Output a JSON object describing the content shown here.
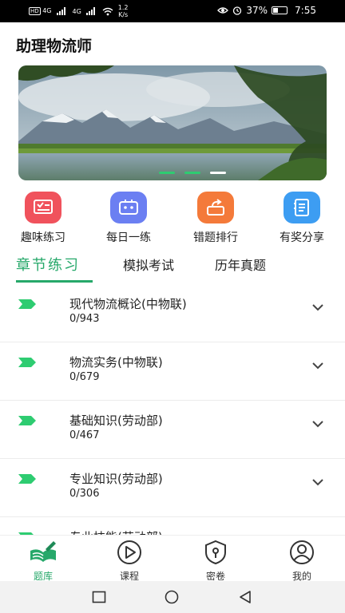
{
  "status_bar": {
    "network_left": "4G",
    "network_left2": "4G",
    "speed_value": "1.2",
    "speed_unit": "K/s",
    "battery": "37%",
    "time": "7:55"
  },
  "header": {
    "title": "助理物流师"
  },
  "banner": {
    "active_dot_index": 2,
    "dot_count": 3
  },
  "quick_menu": [
    {
      "label": "趣味练习",
      "icon": "quiz-icon",
      "color": "#f0525c"
    },
    {
      "label": "每日一练",
      "icon": "daily-icon",
      "color": "#6b7ff2"
    },
    {
      "label": "错题排行",
      "icon": "ranking-icon",
      "color": "#f47a3a"
    },
    {
      "label": "有奖分享",
      "icon": "share-icon",
      "color": "#3d9df2"
    }
  ],
  "tabs": [
    {
      "label": "章节练习",
      "active": true
    },
    {
      "label": "模拟考试",
      "active": false
    },
    {
      "label": "历年真题",
      "active": false
    }
  ],
  "chapters": [
    {
      "name": "现代物流概论(中物联)",
      "progress": "0/943"
    },
    {
      "name": "物流实务(中物联)",
      "progress": "0/679"
    },
    {
      "name": "基础知识(劳动部)",
      "progress": "0/467"
    },
    {
      "name": "专业知识(劳动部)",
      "progress": "0/306"
    },
    {
      "name": "专业技能(劳动部)",
      "progress": ""
    }
  ],
  "bottom_nav": [
    {
      "label": "题库",
      "icon": "question-bank-icon",
      "active": true
    },
    {
      "label": "课程",
      "icon": "play-icon",
      "active": false
    },
    {
      "label": "密卷",
      "icon": "lock-shield-icon",
      "active": false
    },
    {
      "label": "我的",
      "icon": "user-icon",
      "active": false
    }
  ],
  "colors": {
    "accent": "#26a86a",
    "flag": "#2ecc71"
  }
}
